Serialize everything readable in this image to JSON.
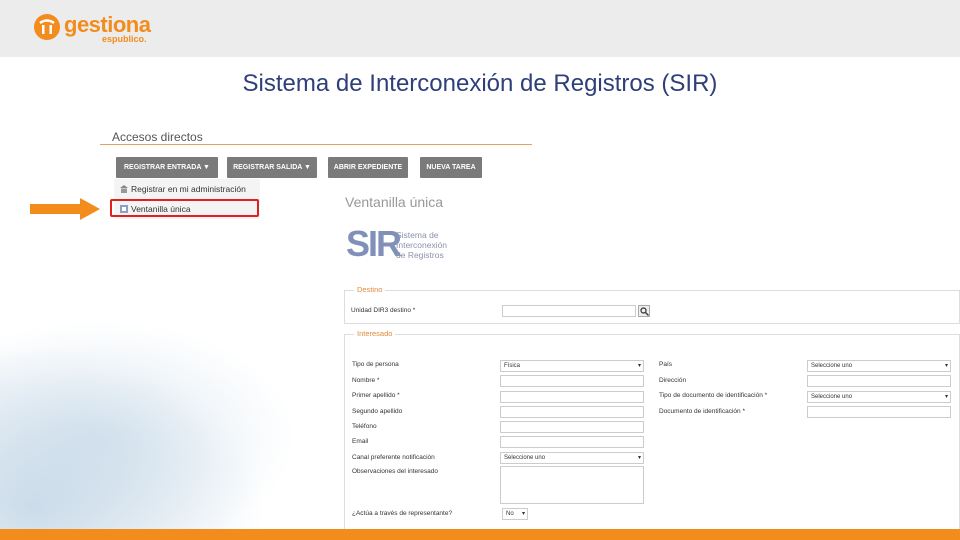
{
  "brand": {
    "name": "gestiona",
    "sub": "espublico.",
    "color": "#f28c1d"
  },
  "slide": {
    "title": "Sistema de Interconexión de Registros (SIR)"
  },
  "accesos": {
    "title": "Accesos directos",
    "buttons": [
      "REGISTRAR ENTRADA ▼",
      "REGISTRAR SALIDA ▼",
      "ABRIR EXPEDIENTE",
      "NUEVA TAREA"
    ],
    "dropdown": [
      "Registrar en mi administración",
      "Ventanilla única"
    ]
  },
  "form": {
    "title": "Ventanilla única",
    "sir_logo": {
      "big": "SIR",
      "line1": "Sistema de",
      "line2": "Interconexión",
      "line3": "de Registros"
    },
    "destino": {
      "legend": "Destino",
      "unidad_label": "Unidad DIR3 destino *",
      "unidad_value": ""
    },
    "interesado": {
      "legend": "Interesado",
      "left": [
        {
          "label": "Tipo de persona",
          "value": "Física"
        },
        {
          "label": "Nombre *",
          "value": ""
        },
        {
          "label": "Primer apellido *",
          "value": ""
        },
        {
          "label": "Segundo apellido",
          "value": ""
        },
        {
          "label": "Teléfono",
          "value": ""
        },
        {
          "label": "Email",
          "value": ""
        },
        {
          "label": "Canal preferente notificación",
          "value": "Seleccione uno"
        },
        {
          "label": "Observaciones del interesado",
          "value": ""
        }
      ],
      "right": [
        {
          "label": "País",
          "value": "Seleccione uno"
        },
        {
          "label": "Dirección",
          "value": ""
        },
        {
          "label": "Tipo de documento de identificación *",
          "value": "Seleccione uno"
        },
        {
          "label": "Documento de identificación *",
          "value": ""
        }
      ],
      "representante_label": "¿Actúa a través de representante?",
      "representante_value": "No"
    }
  }
}
